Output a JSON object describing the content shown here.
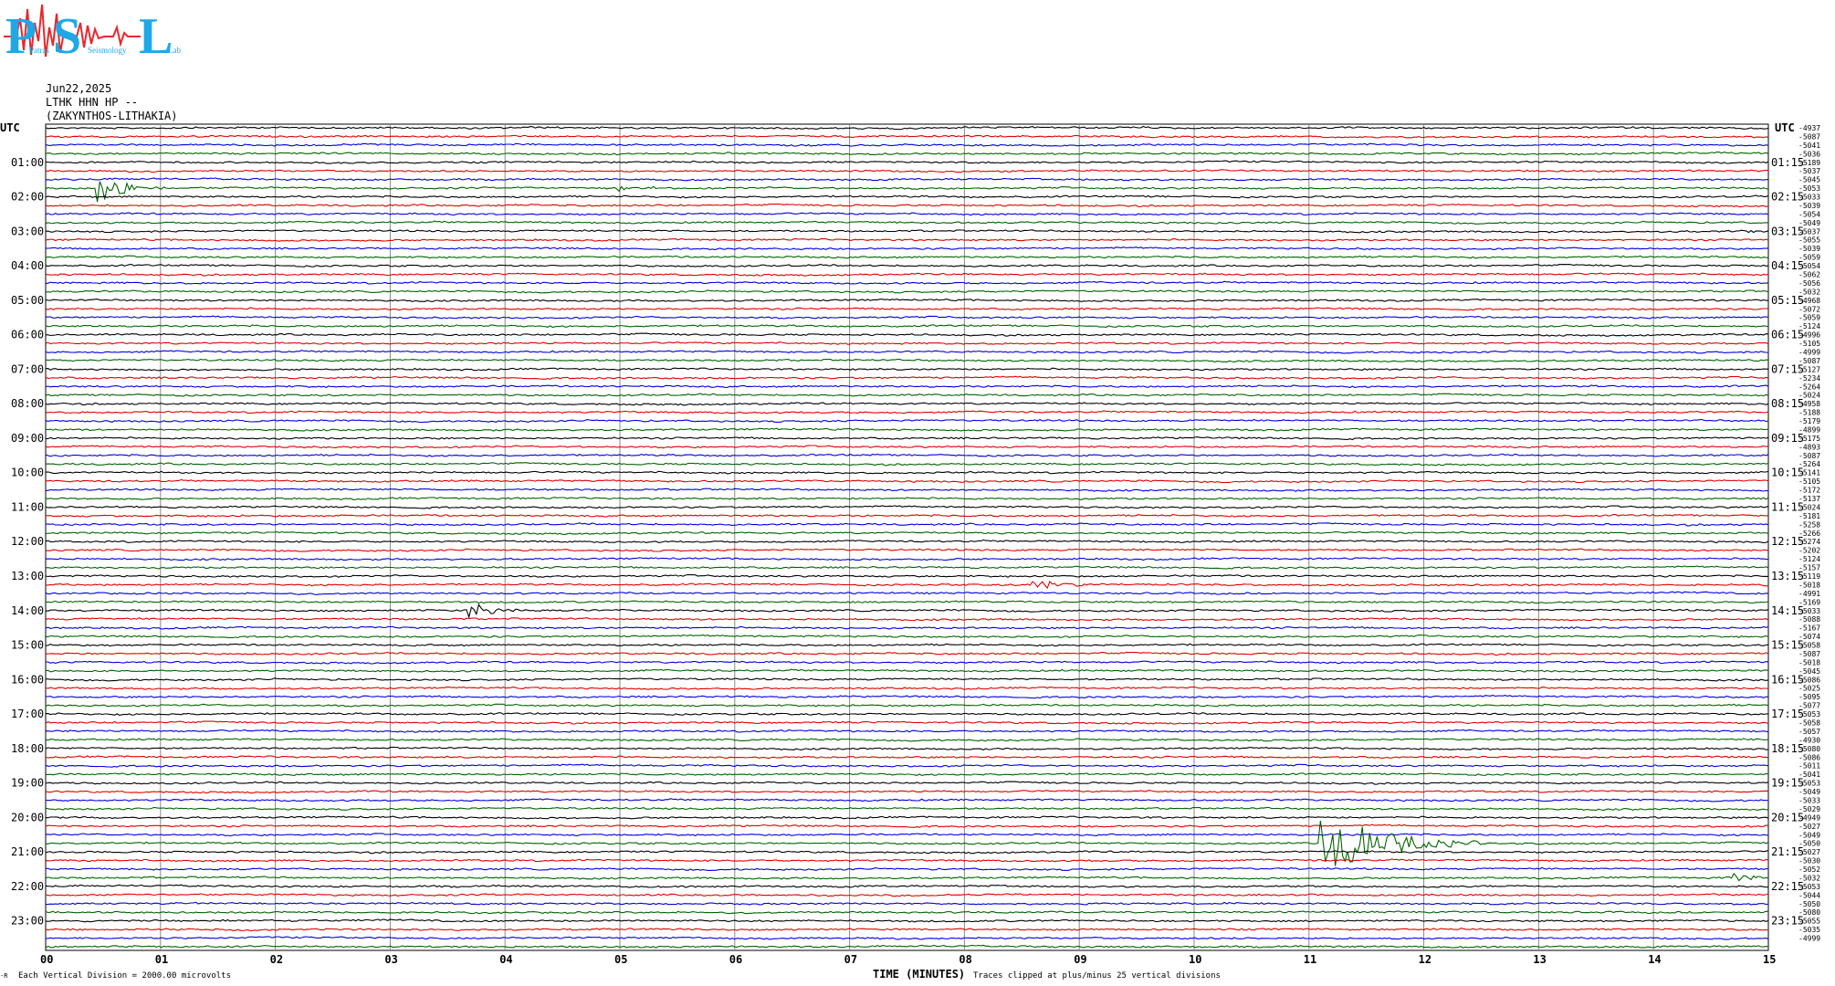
{
  "header": {
    "logo": {
      "big_letters": [
        "P",
        "S",
        "L"
      ],
      "small_words": [
        "Patras",
        "Seismology",
        "Lab"
      ],
      "colors": {
        "letters": "#1ea8e6",
        "trace": "#e8282d"
      }
    },
    "date": "Jun22,2025",
    "channel": "LTHK HHN HP --",
    "station": "(ZAKYNTHOS-LITHAKIA)"
  },
  "chart_data": {
    "type": "line",
    "subtype": "helicorder",
    "left_axis_title": "UTC",
    "right_axis_title": "UTC",
    "left_hour_labels": [
      "01:00",
      "02:00",
      "03:00",
      "04:00",
      "05:00",
      "06:00",
      "07:00",
      "08:00",
      "09:00",
      "10:00",
      "11:00",
      "12:00",
      "13:00",
      "14:00",
      "15:00",
      "16:00",
      "17:00",
      "18:00",
      "19:00",
      "20:00",
      "21:00",
      "22:00",
      "23:00"
    ],
    "right_hour_labels": [
      "01:15",
      "02:15",
      "03:15",
      "04:15",
      "05:15",
      "06:15",
      "07:15",
      "08:15",
      "09:15",
      "10:15",
      "11:15",
      "12:15",
      "13:15",
      "14:15",
      "15:15",
      "16:15",
      "17:15",
      "18:15",
      "19:15",
      "20:15",
      "21:15",
      "22:15",
      "23:15"
    ],
    "x_ticks": [
      "00",
      "01",
      "02",
      "03",
      "04",
      "05",
      "06",
      "07",
      "08",
      "09",
      "10",
      "11",
      "12",
      "13",
      "14",
      "15"
    ],
    "xlim": [
      0,
      15
    ],
    "xlabel": "TIME (MINUTES)",
    "trace_colors": [
      "#000000",
      "#e00000",
      "#0000e0",
      "#006400"
    ],
    "trace_count": 96,
    "right_values": [
      "-4937",
      "-5087",
      "-5041",
      "-5036",
      "-5189",
      "-5037",
      "-5045",
      "-5053",
      "-5033",
      "-5039",
      "-5054",
      "-5049",
      "-5037",
      "-5055",
      "-5039",
      "-5059",
      "-5054",
      "-5062",
      "-5056",
      "-5032",
      "-4968",
      "-5072",
      "-5059",
      "-5124",
      "-4996",
      "-5105",
      "-4999",
      "-5087",
      "-5127",
      "-5234",
      "-5264",
      "-5024",
      "-4958",
      "-5188",
      "-5179",
      "-4899",
      "-5175",
      "-4893",
      "-5087",
      "-5264",
      "-5141",
      "-5105",
      "-5172",
      "-5137",
      "-5024",
      "-5181",
      "-5258",
      "-5266",
      "-5274",
      "-5202",
      "-5124",
      "-5157",
      "-5119",
      "-5018",
      "-4991",
      "-5169",
      "-5033",
      "-5088",
      "-5167",
      "-5074",
      "-5058",
      "-5087",
      "-5018",
      "-5045",
      "-5086",
      "-5025",
      "-5095",
      "-5077",
      "-5053",
      "-5058",
      "-5057",
      "-4930",
      "-5080",
      "-5086",
      "-5011",
      "-5041",
      "-5053",
      "-5049",
      "-5033",
      "-5029",
      "-4949",
      "-5027",
      "-5049",
      "-5050",
      "-5027",
      "-5030",
      "-5052",
      "-5032",
      "-5053",
      "-5044",
      "-5050",
      "-5080",
      "-5055",
      "-5035",
      "-4999"
    ],
    "events": [
      {
        "trace": 7,
        "minute": 0.45,
        "duration_min": 0.6,
        "amplitude_divisions": 4.0
      },
      {
        "trace": 7,
        "minute": 5.0,
        "duration_min": 0.15,
        "amplitude_divisions": 0.6
      },
      {
        "trace": 7,
        "minute": 5.3,
        "duration_min": 0.1,
        "amplitude_divisions": 0.5
      },
      {
        "trace": 12,
        "minute": 14.75,
        "duration_min": 0.2,
        "amplitude_divisions": 0.6
      },
      {
        "trace": 53,
        "minute": 8.6,
        "duration_min": 0.7,
        "amplitude_divisions": 1.5
      },
      {
        "trace": 56,
        "minute": 3.7,
        "duration_min": 0.5,
        "amplitude_divisions": 2.5
      },
      {
        "trace": 83,
        "minute": 11.1,
        "duration_min": 1.4,
        "amplitude_divisions": 8.0
      },
      {
        "trace": 87,
        "minute": 14.7,
        "duration_min": 0.5,
        "amplitude_divisions": 0.8
      }
    ],
    "footer_left": "Each Vertical Division = 2000.00 microvolts",
    "footer_right": "Traces clipped at plus/minus 25 vertical divisions",
    "footer_corner": "-R"
  }
}
